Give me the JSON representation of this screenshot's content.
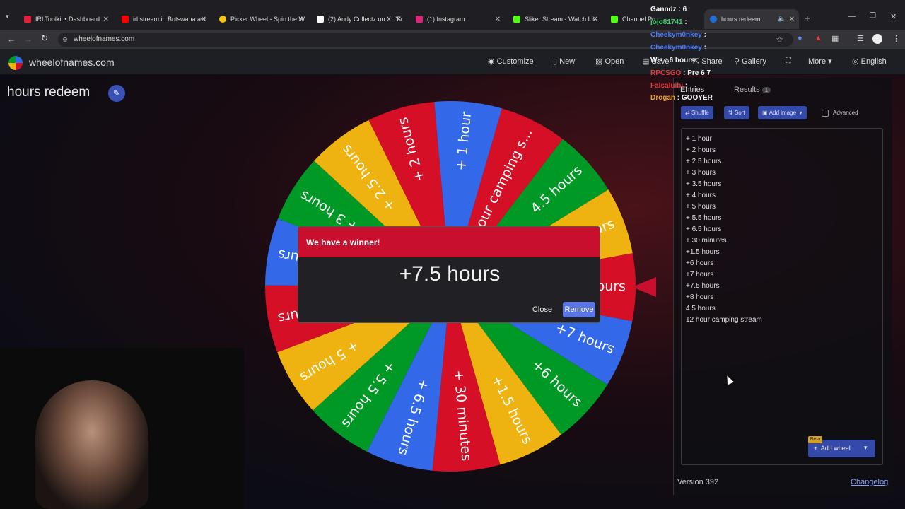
{
  "browser": {
    "tabs": [
      {
        "title": "IRLToolkit • Dashboard",
        "color": "#e0203c"
      },
      {
        "title": "irl stream in Botswana aw",
        "color": "#ff0000"
      },
      {
        "title": "Picker Wheel - Spin the W",
        "color": "#f5c518"
      },
      {
        "title": "(2) Andy Collectz on X: \"Fr",
        "color": "#ffffff"
      },
      {
        "title": "(1) Instagram",
        "color": "#d62976"
      },
      {
        "title": "Sliker Stream - Watch Liv",
        "color": "#53fc18"
      },
      {
        "title": "Channel Po",
        "color": "#53fc18"
      },
      {
        "title": "hours redeem",
        "color": "#1f6fd6"
      }
    ],
    "url": "wheelofnames.com"
  },
  "app": {
    "logo_text": "wheelofnames.com",
    "nav": {
      "customize": "Customize",
      "new": "New",
      "open": "Open",
      "save": "Save",
      "share": "Share",
      "gallery": "Gallery",
      "more": "More",
      "language": "English"
    },
    "page_title": "hours redeem"
  },
  "wheel": {
    "segments": [
      {
        "label": "+ 1 hour",
        "color": "#3369e8"
      },
      {
        "label": "+12 hour camping s...",
        "color": "#d50f25"
      },
      {
        "label": "4.5 hours",
        "color": "#009925"
      },
      {
        "label": "+8 hours",
        "color": "#eeb211"
      },
      {
        "label": "+7.5 hours",
        "color": "#d50f25"
      },
      {
        "label": "+7 hours",
        "color": "#3369e8"
      },
      {
        "label": "+6 hours",
        "color": "#009925"
      },
      {
        "label": "+1.5 hours",
        "color": "#eeb211"
      },
      {
        "label": "+ 30 minutes",
        "color": "#d50f25"
      },
      {
        "label": "+ 6.5 hours",
        "color": "#3369e8"
      },
      {
        "label": "+ 5.5 hours",
        "color": "#009925"
      },
      {
        "label": "+ 5 hours",
        "color": "#eeb211"
      },
      {
        "label": "+ 4 hours",
        "color": "#d50f25"
      },
      {
        "label": "+ 3.5 hours",
        "color": "#3369e8"
      },
      {
        "label": "+ 3 hours",
        "color": "#009925"
      },
      {
        "label": "+ 2.5 hours",
        "color": "#eeb211"
      },
      {
        "label": "+ 2 hours",
        "color": "#d50f25"
      }
    ]
  },
  "dialog": {
    "header": "We have a winner!",
    "winner": "+7.5 hours",
    "close": "Close",
    "remove": "Remove"
  },
  "panel": {
    "tab_entries": "Entries",
    "tab_results": "Results",
    "results_count": "1",
    "shuffle": "Shuffle",
    "sort": "Sort",
    "add_image": "Add image",
    "advanced": "Advanced",
    "entries": [
      "+ 1 hour",
      "+ 2 hours",
      "+ 2.5 hours",
      "+ 3 hours",
      "+ 3.5 hours",
      "+ 4 hours",
      "+ 5 hours",
      "+ 5.5 hours",
      "+ 6.5 hours",
      "+ 30 minutes",
      "+1.5 hours",
      "+6 hours",
      "+7 hours",
      "+7.5 hours",
      "+8 hours",
      "4.5 hours",
      "12 hour camping stream"
    ],
    "add_wheel": "Add wheel",
    "beta": "Beta",
    "version": "Version 392",
    "changelog": "Changelog"
  },
  "chat": [
    {
      "user": "Ganndz",
      "text": "6",
      "color": "#ffffff"
    },
    {
      "user": "jojo81741",
      "text": "",
      "color": "#3bd16f"
    },
    {
      "user": "Cheekym0nkey",
      "text": "",
      "color": "#4a7bff"
    },
    {
      "user": "Cheekym0nkey",
      "text": "",
      "color": "#4a7bff"
    },
    {
      "user": "Wis",
      "text": "6 hours",
      "color": "#ffffff"
    },
    {
      "user": "RPCSGO",
      "text": "Pre 6 7",
      "color": "#e03c3c"
    },
    {
      "user": "Falsaluibi",
      "text": "",
      "color": "#e03c3c"
    },
    {
      "user": "Drogan",
      "text": "GOOYER",
      "color": "#e5a126"
    }
  ]
}
